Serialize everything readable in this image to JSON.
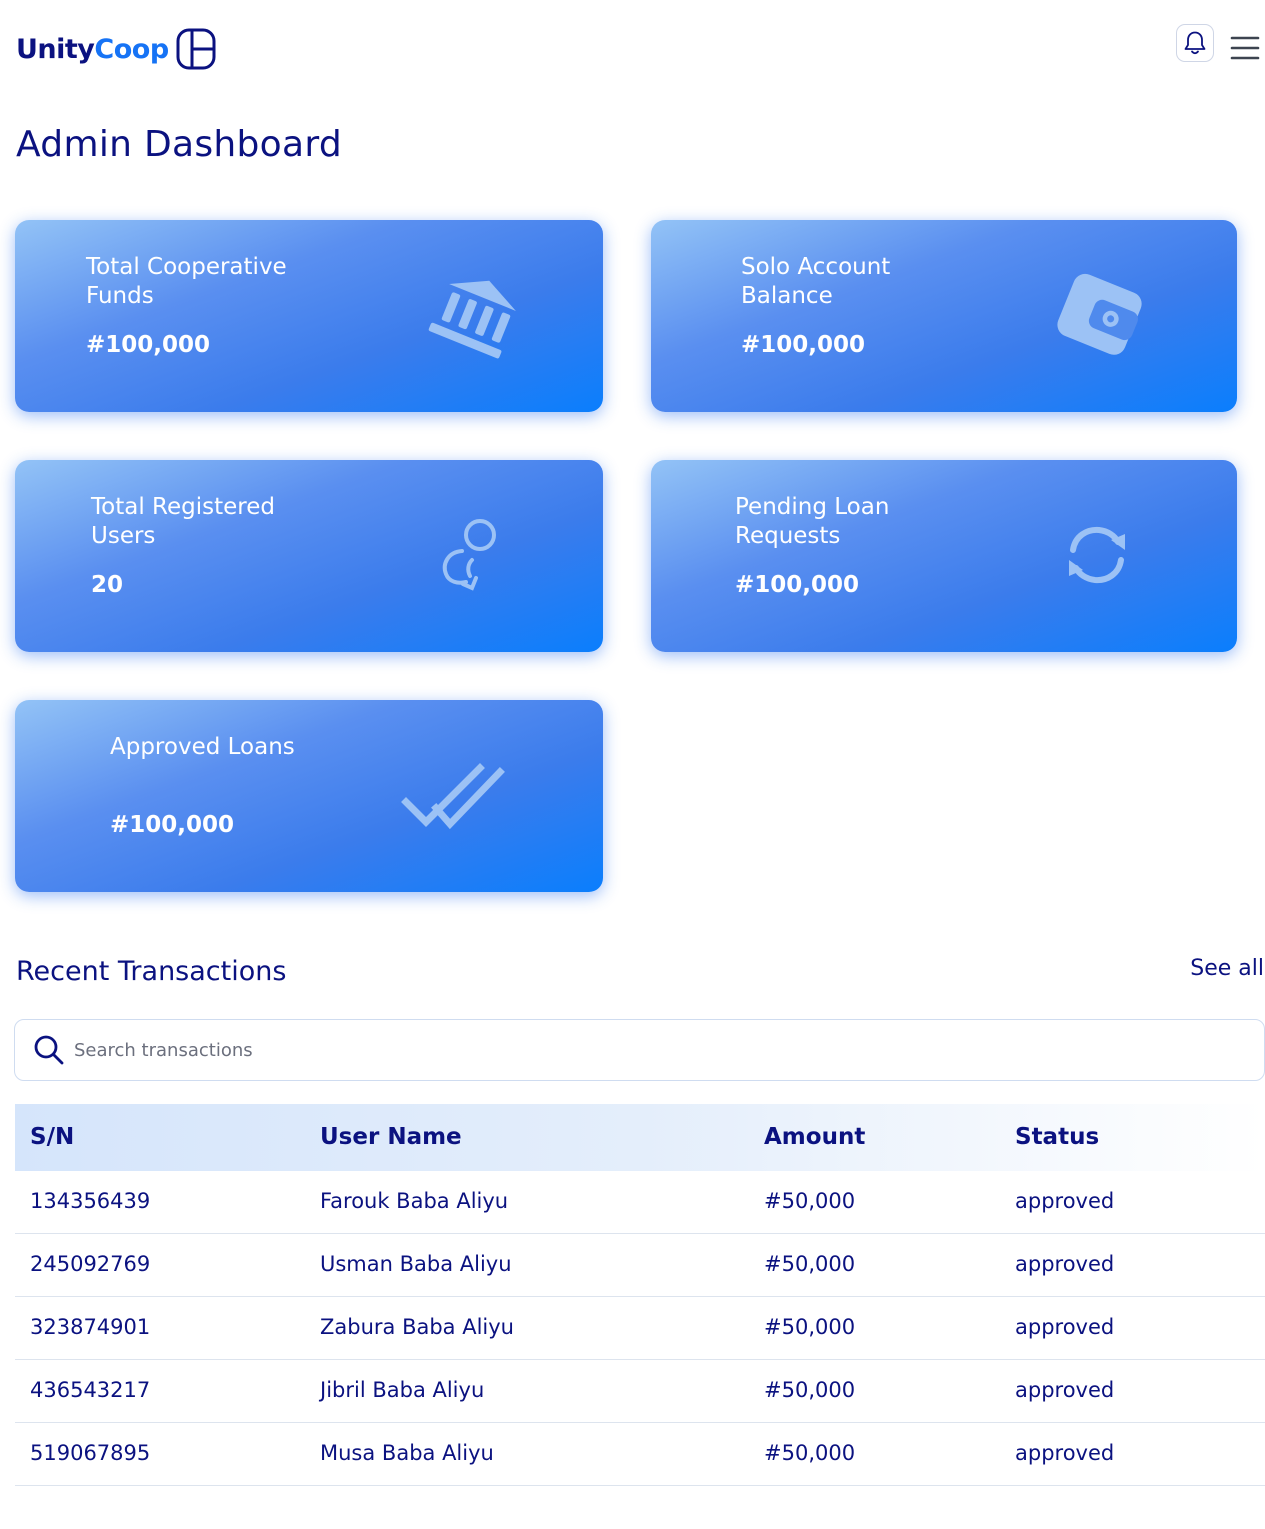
{
  "brand": {
    "name_part1": "Unity",
    "name_part2": "Coop"
  },
  "header": {
    "notification_icon": "bell-icon",
    "menu_icon": "hamburger-menu-icon"
  },
  "page": {
    "title": "Admin Dashboard"
  },
  "cards": [
    {
      "label": "Total Cooperative Funds",
      "value": "#100,000",
      "icon": "bank-icon"
    },
    {
      "label": "Solo Account Balance",
      "value": "#100,000",
      "icon": "wallet-icon"
    },
    {
      "label": "Total Registered Users",
      "value": "20",
      "icon": "users-icon"
    },
    {
      "label": "Pending Loan Requests",
      "value": "#100,000",
      "icon": "refresh-icon"
    },
    {
      "label": "Approved Loans",
      "value": "#100,000",
      "icon": "double-check-icon"
    }
  ],
  "transactions": {
    "title": "Recent Transactions",
    "see_all": "See all",
    "search_placeholder": "Search transactions",
    "columns": [
      "S/N",
      "User Name",
      "Amount",
      "Status"
    ],
    "rows": [
      {
        "sn": "134356439",
        "name": "Farouk Baba Aliyu",
        "amount": "#50,000",
        "status": "approved"
      },
      {
        "sn": "245092769",
        "name": "Usman Baba Aliyu",
        "amount": "#50,000",
        "status": "approved"
      },
      {
        "sn": "323874901",
        "name": "Zabura Baba Aliyu",
        "amount": "#50,000",
        "status": "approved"
      },
      {
        "sn": "436543217",
        "name": "Jibril Baba Aliyu",
        "amount": "#50,000",
        "status": "approved"
      },
      {
        "sn": "519067895",
        "name": "Musa Baba Aliyu",
        "amount": "#50,000",
        "status": "approved"
      }
    ]
  },
  "colors": {
    "brand_navy": "#0b1280",
    "brand_blue": "#1673f5",
    "card_gradient_start": "#93c3f6",
    "card_gradient_end": "#0a7efd"
  }
}
